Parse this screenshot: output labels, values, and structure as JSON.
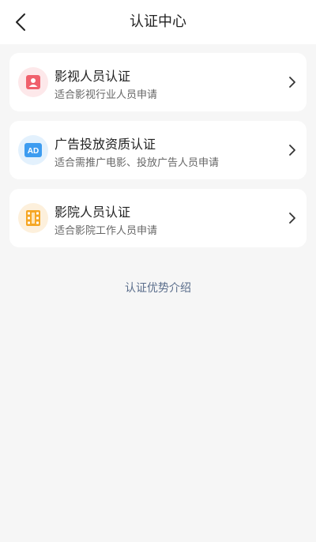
{
  "header": {
    "title": "认证中心",
    "back_icon": "chevron-left-icon"
  },
  "cards": [
    {
      "title": "影视人员认证",
      "subtitle": "适合影视行业人员申请",
      "icon": "person-id-icon",
      "icon_color": "#f0606c"
    },
    {
      "title": "广告投放资质认证",
      "subtitle": "适合需推广电影、投放广告人员申请",
      "icon": "ad-icon",
      "icon_label": "AD",
      "icon_color": "#3d9cf0"
    },
    {
      "title": "影院人员认证",
      "subtitle": "适合影院工作人员申请",
      "icon": "film-icon",
      "icon_color": "#f5a623"
    }
  ],
  "footer_link": "认证优势介绍",
  "colors": {
    "background": "#f6f6f6",
    "card": "#ffffff",
    "link": "#5b6e8c"
  }
}
